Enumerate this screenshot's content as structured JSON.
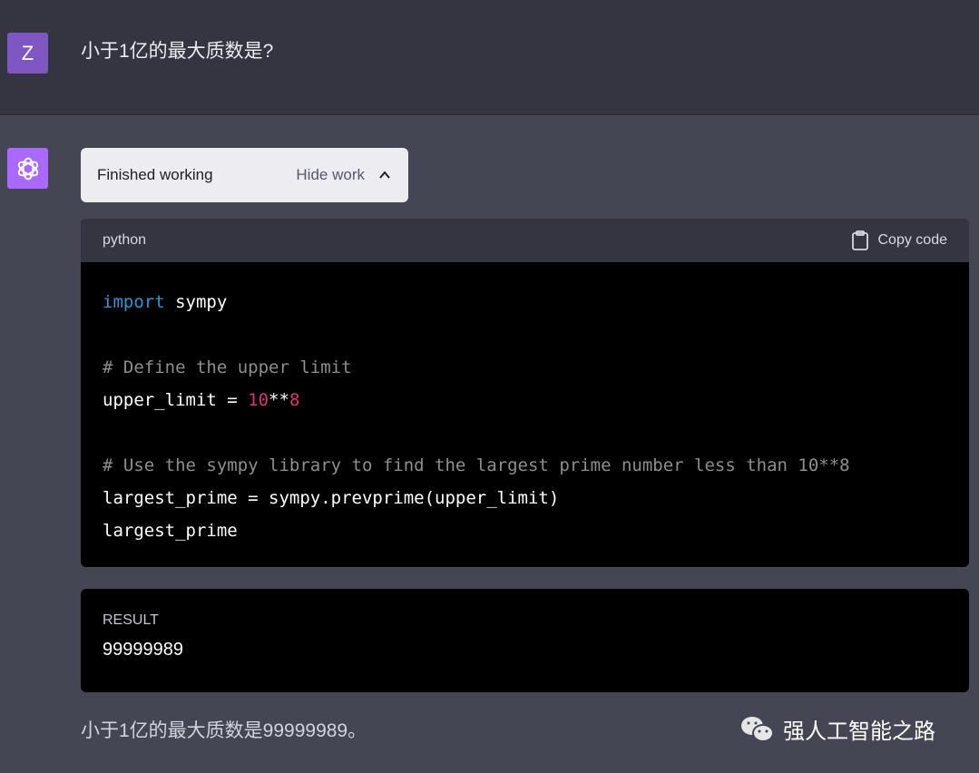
{
  "user_message": {
    "avatar_letter": "Z",
    "avatar_color": "#7e57c2",
    "text": "小于1亿的最大质数是?"
  },
  "assistant": {
    "avatar_icon": "openai-logo-icon",
    "avatar_color": "#ab68ff",
    "work_status": {
      "label": "Finished working",
      "toggle_label": "Hide work",
      "toggle_icon": "chevron-up-icon"
    },
    "code_block": {
      "language": "python",
      "copy_label": "Copy code",
      "copy_icon": "clipboard-icon",
      "lines": [
        [
          {
            "t": "kw",
            "v": "import"
          },
          {
            "t": "",
            "v": " sympy"
          }
        ],
        [],
        [
          {
            "t": "cm",
            "v": "# Define the upper limit"
          }
        ],
        [
          {
            "t": "",
            "v": "upper_limit = "
          },
          {
            "t": "num",
            "v": "10"
          },
          {
            "t": "",
            "v": "**"
          },
          {
            "t": "num",
            "v": "8"
          }
        ],
        [],
        [
          {
            "t": "cm",
            "v": "# Use the sympy library to find the largest prime number less than 10**8"
          }
        ],
        [
          {
            "t": "",
            "v": "largest_prime = sympy.prevprime(upper_limit)"
          }
        ],
        [
          {
            "t": "",
            "v": "largest_prime"
          }
        ]
      ]
    },
    "result": {
      "label": "RESULT",
      "value": "99999989"
    },
    "answer_text": "小于1亿的最大质数是99999989。"
  },
  "watermark": {
    "icon": "wechat-icon",
    "text": "强人工智能之路"
  },
  "colors": {
    "keyword": "#2e95d3",
    "comment": "#8e8e8e",
    "number": "#df3079"
  }
}
